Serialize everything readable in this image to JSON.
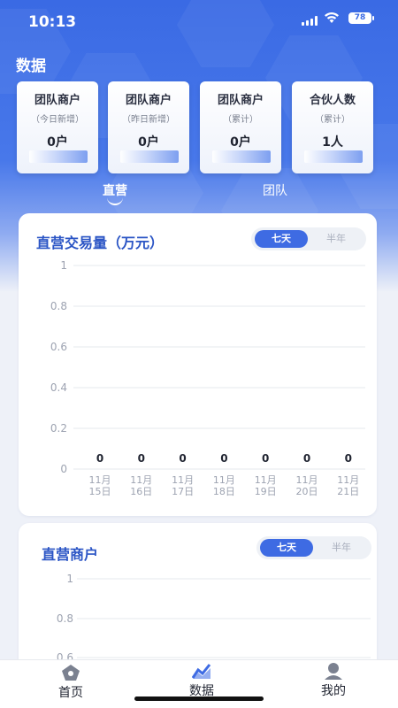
{
  "status_bar": {
    "time": "10:13",
    "battery": "78"
  },
  "header": {
    "title": "数据"
  },
  "stats": [
    {
      "title": "团队商户",
      "sub": "（今日新增）",
      "value": "0户"
    },
    {
      "title": "团队商户",
      "sub": "（昨日新增）",
      "value": "0户"
    },
    {
      "title": "团队商户",
      "sub": "（累计）",
      "value": "0户"
    },
    {
      "title": "合伙人数",
      "sub": "（累计）",
      "value": "1人"
    }
  ],
  "segments": {
    "direct": "直营",
    "team": "团队"
  },
  "toggle": {
    "seven_days": "七天",
    "half_year": "半年"
  },
  "chart_data": [
    {
      "type": "line",
      "title": "直营交易量（万元）",
      "categories": [
        "11月15日",
        "11月16日",
        "11月17日",
        "11月18日",
        "11月19日",
        "11月20日",
        "11月21日"
      ],
      "category_lines": [
        [
          "11月",
          "15日"
        ],
        [
          "11月",
          "16日"
        ],
        [
          "11月",
          "17日"
        ],
        [
          "11月",
          "18日"
        ],
        [
          "11月",
          "19日"
        ],
        [
          "11月",
          "20日"
        ],
        [
          "11月",
          "21日"
        ]
      ],
      "values": [
        0,
        0,
        0,
        0,
        0,
        0,
        0
      ],
      "yticks": [
        "0",
        "0.2",
        "0.4",
        "0.6",
        "0.8",
        "1"
      ],
      "ylim": [
        0,
        1
      ],
      "grid": true,
      "legend": "none",
      "colors": {
        "gridline": "#e6e8ee"
      }
    },
    {
      "type": "line",
      "title": "直营商户",
      "visible_yticks": [
        "0.6",
        "0.8",
        "1"
      ],
      "ylim": [
        0,
        1
      ],
      "grid": true,
      "legend": "none",
      "colors": {
        "gridline": "#e6e8ee"
      }
    }
  ],
  "tabbar": [
    {
      "label": "首页",
      "icon": "home-icon"
    },
    {
      "label": "数据",
      "icon": "chart-icon"
    },
    {
      "label": "我的",
      "icon": "profile-icon"
    }
  ],
  "colors": {
    "accent": "#3e6be3",
    "hero": "#3a6ae4",
    "chart_title": "#2b55c5"
  }
}
